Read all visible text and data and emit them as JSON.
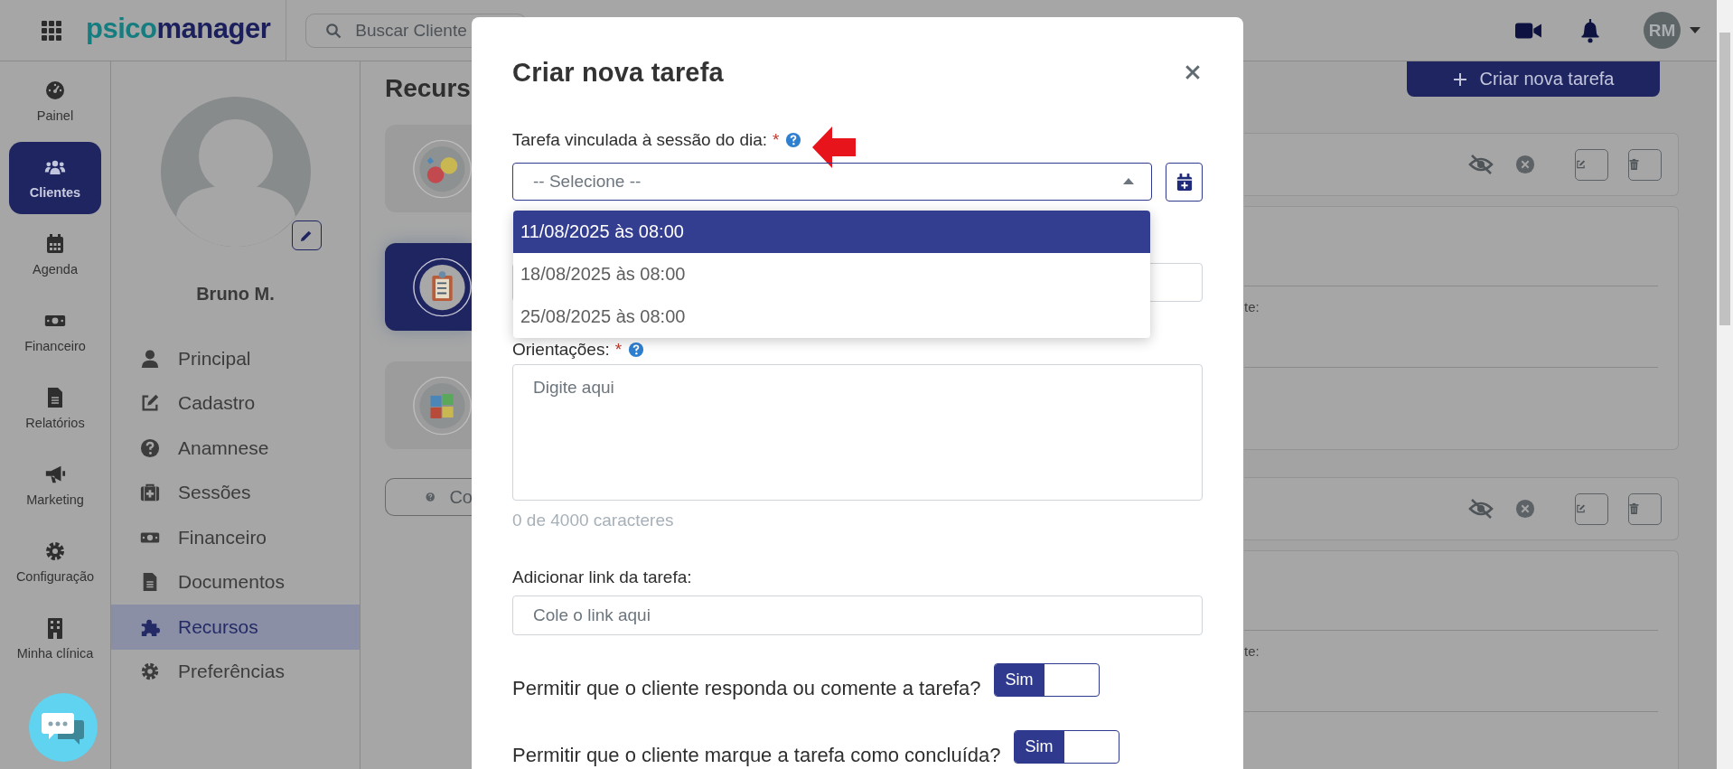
{
  "header": {
    "logo": {
      "parts": [
        "psico",
        "manager"
      ]
    },
    "search": {
      "placeholder": "Buscar Cliente"
    },
    "avatar": "RM"
  },
  "nav": [
    {
      "label": "Painel",
      "selected": false
    },
    {
      "label": "Clientes",
      "selected": true
    },
    {
      "label": "Agenda",
      "selected": false
    },
    {
      "label": "Financeiro",
      "selected": false
    },
    {
      "label": "Relatórios",
      "selected": false
    },
    {
      "label": "Marketing",
      "selected": false
    },
    {
      "label": "Configuração",
      "selected": false
    },
    {
      "label": "Minha clínica",
      "selected": false
    }
  ],
  "client": {
    "name": "Bruno M."
  },
  "client_menu": [
    {
      "label": "Principal",
      "selected": false
    },
    {
      "label": "Cadastro",
      "selected": false
    },
    {
      "label": "Anamnese",
      "selected": false
    },
    {
      "label": "Sessões",
      "selected": false
    },
    {
      "label": "Financeiro",
      "selected": false
    },
    {
      "label": "Documentos",
      "selected": false
    },
    {
      "label": "Recursos",
      "selected": true
    },
    {
      "label": "Preferências",
      "selected": false
    }
  ],
  "resources": {
    "title": "Recurs",
    "cards": [
      {
        "selected": false
      },
      {
        "selected": true
      },
      {
        "selected": false
      }
    ],
    "help_button": "Co"
  },
  "new_task_button": "Criar nova tarefa",
  "task_panels": [
    {
      "field_label": "te:"
    },
    {
      "field_label": "te:"
    }
  ],
  "modal": {
    "title": "Criar nova tarefa",
    "session_field": {
      "label": "Tarefa vinculada à sessão do dia:",
      "required_mark": "*",
      "placeholder": "-- Selecione --",
      "expanded": true,
      "options": [
        {
          "label": "11/08/2025 às 08:00",
          "selected": true
        },
        {
          "label": "18/08/2025 às 08:00",
          "selected": false
        },
        {
          "label": "25/08/2025 às 08:00",
          "selected": false
        }
      ]
    },
    "guidance_field": {
      "label": "Orientações:",
      "required_mark": "*",
      "placeholder": "Digite aqui",
      "counter": "0 de 4000 caracteres"
    },
    "link_field": {
      "label": "Adicionar link da tarefa:",
      "placeholder": "Cole o link aqui"
    },
    "toggles": [
      {
        "label": "Permitir que o cliente responda ou comente a tarefa?",
        "on": true,
        "state_label": "Sim"
      },
      {
        "label": "Permitir que o cliente marque a tarefa como concluída?",
        "on": true,
        "state_label": "Sim"
      }
    ]
  }
}
